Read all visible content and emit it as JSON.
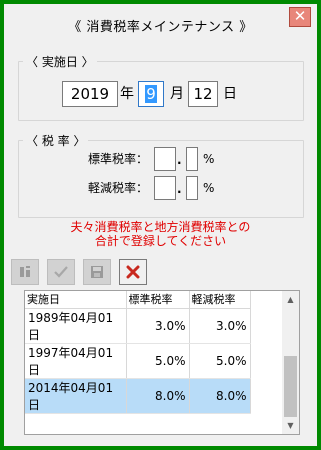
{
  "window": {
    "title": "《 消費税率メインテナンス 》",
    "close_glyph": "✕",
    "frame_color": "#008a00"
  },
  "date_group": {
    "legend": "〈 実施日 〉",
    "year": "2019",
    "year_unit": "年",
    "month": "9",
    "month_unit": "月",
    "day": "12",
    "day_unit": "日"
  },
  "tax_group": {
    "legend": "〈 税 率 〉",
    "standard_label": "標準税率：",
    "reduced_label": "軽減税率：",
    "standard_int": "",
    "standard_dec": "",
    "reduced_int": "",
    "reduced_dec": "",
    "decimal_point": ".",
    "percent": "%"
  },
  "notice": {
    "line1": "夫々消費税率と地方消費税率との",
    "line2": "合計で登録してください",
    "color": "#e00000"
  },
  "toolbar": {
    "buttons": [
      {
        "icon": "edit-icon",
        "enabled": false
      },
      {
        "icon": "check-icon",
        "enabled": false
      },
      {
        "icon": "save-icon",
        "enabled": false
      },
      {
        "icon": "delete-x-icon",
        "enabled": true
      }
    ]
  },
  "grid": {
    "headers": [
      "実施日",
      "標準税率",
      "軽減税率"
    ],
    "rows": [
      {
        "date": "1989年04月01日",
        "standard": "3.0%",
        "reduced": "3.0%",
        "selected": false
      },
      {
        "date": "1997年04月01日",
        "standard": "5.0%",
        "reduced": "5.0%",
        "selected": false
      },
      {
        "date": "2014年04月01日",
        "standard": "8.0%",
        "reduced": "8.0%",
        "selected": true
      }
    ],
    "selected_color": "#b8dcf8"
  }
}
